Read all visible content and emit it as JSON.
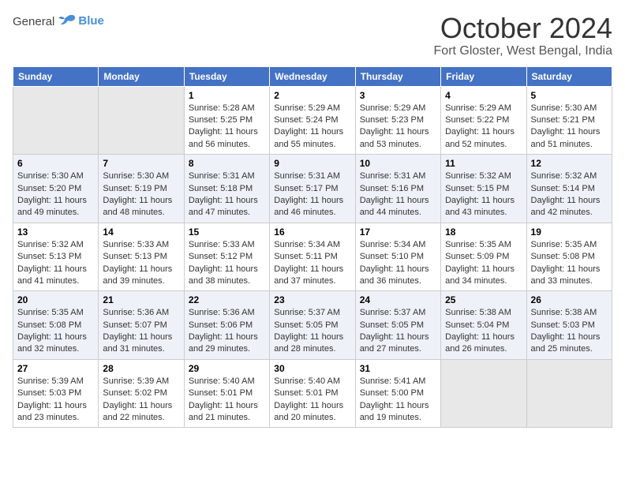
{
  "header": {
    "logo_general": "General",
    "logo_blue": "Blue",
    "title": "October 2024",
    "location": "Fort Gloster, West Bengal, India"
  },
  "weekdays": [
    "Sunday",
    "Monday",
    "Tuesday",
    "Wednesday",
    "Thursday",
    "Friday",
    "Saturday"
  ],
  "weeks": [
    [
      {
        "num": "",
        "empty": true
      },
      {
        "num": "",
        "empty": true
      },
      {
        "num": "1",
        "sunrise": "Sunrise: 5:28 AM",
        "sunset": "Sunset: 5:25 PM",
        "daylight": "Daylight: 11 hours and 56 minutes."
      },
      {
        "num": "2",
        "sunrise": "Sunrise: 5:29 AM",
        "sunset": "Sunset: 5:24 PM",
        "daylight": "Daylight: 11 hours and 55 minutes."
      },
      {
        "num": "3",
        "sunrise": "Sunrise: 5:29 AM",
        "sunset": "Sunset: 5:23 PM",
        "daylight": "Daylight: 11 hours and 53 minutes."
      },
      {
        "num": "4",
        "sunrise": "Sunrise: 5:29 AM",
        "sunset": "Sunset: 5:22 PM",
        "daylight": "Daylight: 11 hours and 52 minutes."
      },
      {
        "num": "5",
        "sunrise": "Sunrise: 5:30 AM",
        "sunset": "Sunset: 5:21 PM",
        "daylight": "Daylight: 11 hours and 51 minutes."
      }
    ],
    [
      {
        "num": "6",
        "sunrise": "Sunrise: 5:30 AM",
        "sunset": "Sunset: 5:20 PM",
        "daylight": "Daylight: 11 hours and 49 minutes."
      },
      {
        "num": "7",
        "sunrise": "Sunrise: 5:30 AM",
        "sunset": "Sunset: 5:19 PM",
        "daylight": "Daylight: 11 hours and 48 minutes."
      },
      {
        "num": "8",
        "sunrise": "Sunrise: 5:31 AM",
        "sunset": "Sunset: 5:18 PM",
        "daylight": "Daylight: 11 hours and 47 minutes."
      },
      {
        "num": "9",
        "sunrise": "Sunrise: 5:31 AM",
        "sunset": "Sunset: 5:17 PM",
        "daylight": "Daylight: 11 hours and 46 minutes."
      },
      {
        "num": "10",
        "sunrise": "Sunrise: 5:31 AM",
        "sunset": "Sunset: 5:16 PM",
        "daylight": "Daylight: 11 hours and 44 minutes."
      },
      {
        "num": "11",
        "sunrise": "Sunrise: 5:32 AM",
        "sunset": "Sunset: 5:15 PM",
        "daylight": "Daylight: 11 hours and 43 minutes."
      },
      {
        "num": "12",
        "sunrise": "Sunrise: 5:32 AM",
        "sunset": "Sunset: 5:14 PM",
        "daylight": "Daylight: 11 hours and 42 minutes."
      }
    ],
    [
      {
        "num": "13",
        "sunrise": "Sunrise: 5:32 AM",
        "sunset": "Sunset: 5:13 PM",
        "daylight": "Daylight: 11 hours and 41 minutes."
      },
      {
        "num": "14",
        "sunrise": "Sunrise: 5:33 AM",
        "sunset": "Sunset: 5:13 PM",
        "daylight": "Daylight: 11 hours and 39 minutes."
      },
      {
        "num": "15",
        "sunrise": "Sunrise: 5:33 AM",
        "sunset": "Sunset: 5:12 PM",
        "daylight": "Daylight: 11 hours and 38 minutes."
      },
      {
        "num": "16",
        "sunrise": "Sunrise: 5:34 AM",
        "sunset": "Sunset: 5:11 PM",
        "daylight": "Daylight: 11 hours and 37 minutes."
      },
      {
        "num": "17",
        "sunrise": "Sunrise: 5:34 AM",
        "sunset": "Sunset: 5:10 PM",
        "daylight": "Daylight: 11 hours and 36 minutes."
      },
      {
        "num": "18",
        "sunrise": "Sunrise: 5:35 AM",
        "sunset": "Sunset: 5:09 PM",
        "daylight": "Daylight: 11 hours and 34 minutes."
      },
      {
        "num": "19",
        "sunrise": "Sunrise: 5:35 AM",
        "sunset": "Sunset: 5:08 PM",
        "daylight": "Daylight: 11 hours and 33 minutes."
      }
    ],
    [
      {
        "num": "20",
        "sunrise": "Sunrise: 5:35 AM",
        "sunset": "Sunset: 5:08 PM",
        "daylight": "Daylight: 11 hours and 32 minutes."
      },
      {
        "num": "21",
        "sunrise": "Sunrise: 5:36 AM",
        "sunset": "Sunset: 5:07 PM",
        "daylight": "Daylight: 11 hours and 31 minutes."
      },
      {
        "num": "22",
        "sunrise": "Sunrise: 5:36 AM",
        "sunset": "Sunset: 5:06 PM",
        "daylight": "Daylight: 11 hours and 29 minutes."
      },
      {
        "num": "23",
        "sunrise": "Sunrise: 5:37 AM",
        "sunset": "Sunset: 5:05 PM",
        "daylight": "Daylight: 11 hours and 28 minutes."
      },
      {
        "num": "24",
        "sunrise": "Sunrise: 5:37 AM",
        "sunset": "Sunset: 5:05 PM",
        "daylight": "Daylight: 11 hours and 27 minutes."
      },
      {
        "num": "25",
        "sunrise": "Sunrise: 5:38 AM",
        "sunset": "Sunset: 5:04 PM",
        "daylight": "Daylight: 11 hours and 26 minutes."
      },
      {
        "num": "26",
        "sunrise": "Sunrise: 5:38 AM",
        "sunset": "Sunset: 5:03 PM",
        "daylight": "Daylight: 11 hours and 25 minutes."
      }
    ],
    [
      {
        "num": "27",
        "sunrise": "Sunrise: 5:39 AM",
        "sunset": "Sunset: 5:03 PM",
        "daylight": "Daylight: 11 hours and 23 minutes."
      },
      {
        "num": "28",
        "sunrise": "Sunrise: 5:39 AM",
        "sunset": "Sunset: 5:02 PM",
        "daylight": "Daylight: 11 hours and 22 minutes."
      },
      {
        "num": "29",
        "sunrise": "Sunrise: 5:40 AM",
        "sunset": "Sunset: 5:01 PM",
        "daylight": "Daylight: 11 hours and 21 minutes."
      },
      {
        "num": "30",
        "sunrise": "Sunrise: 5:40 AM",
        "sunset": "Sunset: 5:01 PM",
        "daylight": "Daylight: 11 hours and 20 minutes."
      },
      {
        "num": "31",
        "sunrise": "Sunrise: 5:41 AM",
        "sunset": "Sunset: 5:00 PM",
        "daylight": "Daylight: 11 hours and 19 minutes."
      },
      {
        "num": "",
        "empty": true
      },
      {
        "num": "",
        "empty": true
      }
    ]
  ]
}
